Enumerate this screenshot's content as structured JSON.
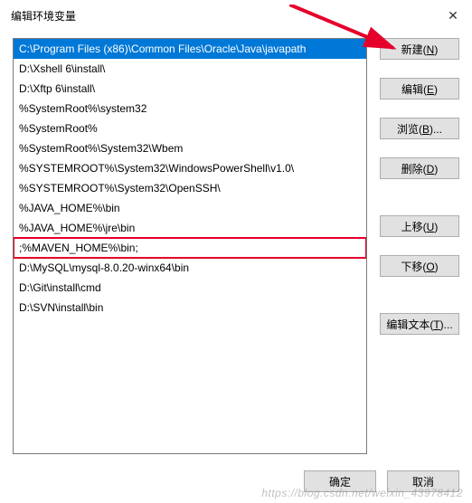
{
  "titlebar": {
    "title": "编辑环境变量"
  },
  "list": {
    "items": [
      "C:\\Program Files (x86)\\Common Files\\Oracle\\Java\\javapath",
      "D:\\Xshell 6\\install\\",
      "D:\\Xftp 6\\install\\",
      "%SystemRoot%\\system32",
      "%SystemRoot%",
      "%SystemRoot%\\System32\\Wbem",
      "%SYSTEMROOT%\\System32\\WindowsPowerShell\\v1.0\\",
      "%SYSTEMROOT%\\System32\\OpenSSH\\",
      "%JAVA_HOME%\\bin",
      "%JAVA_HOME%\\jre\\bin",
      ";%MAVEN_HOME%\\bin;",
      "D:\\MySQL\\mysql-8.0.20-winx64\\bin",
      "D:\\Git\\install\\cmd",
      "D:\\SVN\\install\\bin"
    ],
    "selected_index": 0,
    "highlight_index": 10
  },
  "buttons": {
    "new": "新建(N)",
    "edit": "编辑(E)",
    "browse": "浏览(B)...",
    "delete": "删除(D)",
    "move_up": "上移(U)",
    "move_down": "下移(O)",
    "edit_text": "编辑文本(T)..."
  },
  "footer": {
    "ok": "确定",
    "cancel": "取消"
  },
  "watermark": "https://blog.csdn.net/weixin_43978412"
}
